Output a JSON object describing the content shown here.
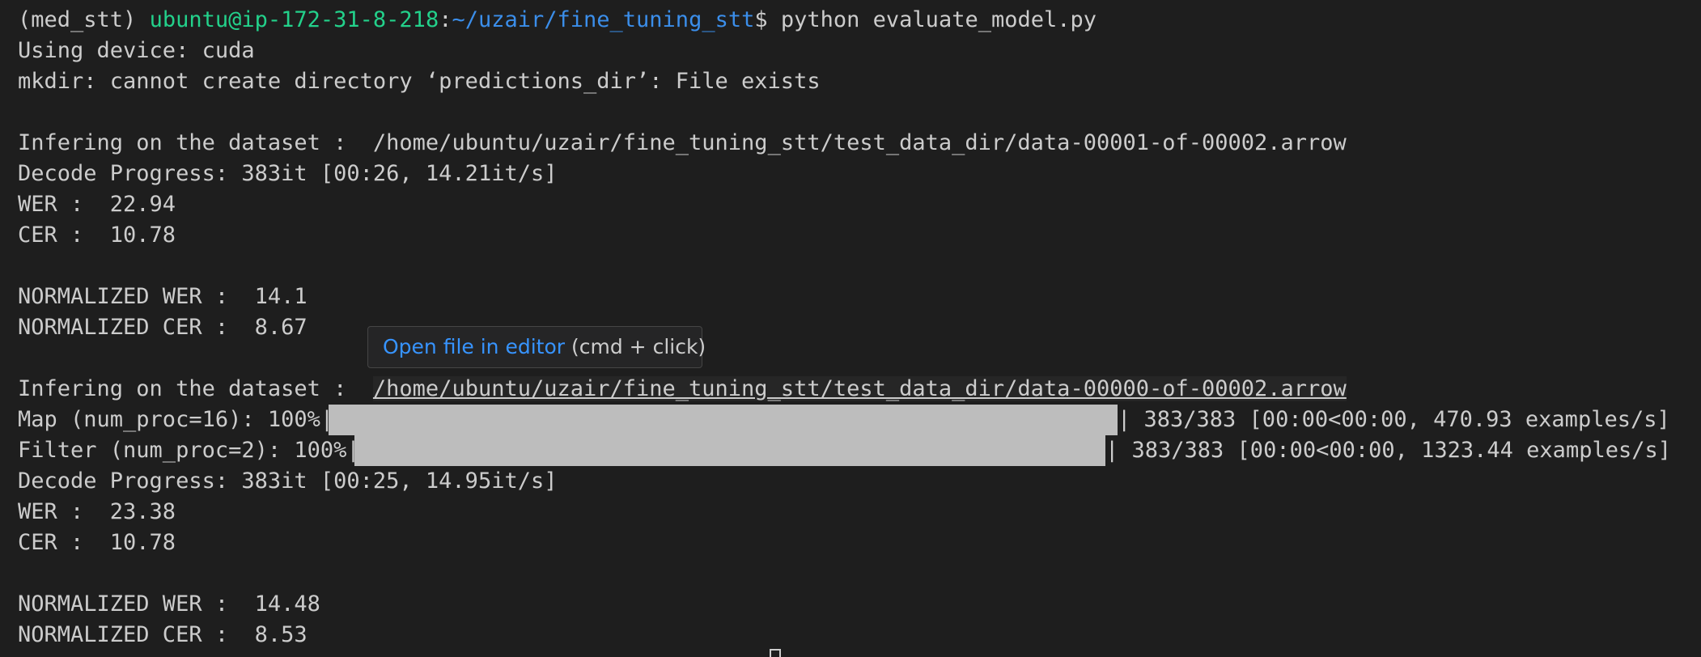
{
  "terminal": {
    "prompt_env": "(med_stt)",
    "prompt_user": "ubuntu@ip-172-31-8-218",
    "prompt_sep": ":",
    "prompt_path": "~/uzair/fine_tuning_stt",
    "prompt_symbol": "$",
    "command": "python evaluate_model.py",
    "lines": {
      "device": "Using device: cuda",
      "mkdir": "mkdir: cannot create directory ‘predictions_dir’: File exists",
      "infer1_label": "Infering on the dataset :  ",
      "infer1_path": "/home/ubuntu/uzair/fine_tuning_stt/test_data_dir/data-00001-of-00002.arrow",
      "decode1": "Decode Progress: 383it [00:26, 14.21it/s]",
      "wer1": "WER :  22.94",
      "cer1": "CER :  10.78",
      "nwer1": "NORMALIZED WER :  14.1",
      "ncer1": "NORMALIZED CER :  8.67",
      "infer2_label": "Infering on the dataset :  ",
      "infer2_path": "/home/ubuntu/uzair/fine_tuning_stt/test_data_dir/data-00000-of-00002.arrow",
      "map_label": "Map (num_proc=16): 100%|",
      "map_stats": "| 383/383 [00:00<00:00, 470.93 examples/s]",
      "filter_label": "Filter (num_proc=2): 100%|",
      "filter_stats": "| 383/383 [00:00<00:00, 1323.44 examples/s]",
      "decode2": "Decode Progress: 383it [00:25, 14.95it/s]",
      "wer2": "WER :  23.38",
      "cer2": "CER :  10.78",
      "nwer2": "NORMALIZED WER :  14.48",
      "ncer2": "NORMALIZED CER :  8.53"
    },
    "progress": {
      "map_percent": 100,
      "filter_percent": 100
    },
    "tooltip": {
      "link_text": "Open file in editor",
      "hint": " (cmd + click)"
    },
    "colors": {
      "background": "#1e1e1e",
      "text": "#cccccc",
      "user_host": "#23d18b",
      "path": "#3b8eea",
      "tooltip_link": "#3794ff",
      "progress_fill": "#bdbdbd"
    }
  }
}
